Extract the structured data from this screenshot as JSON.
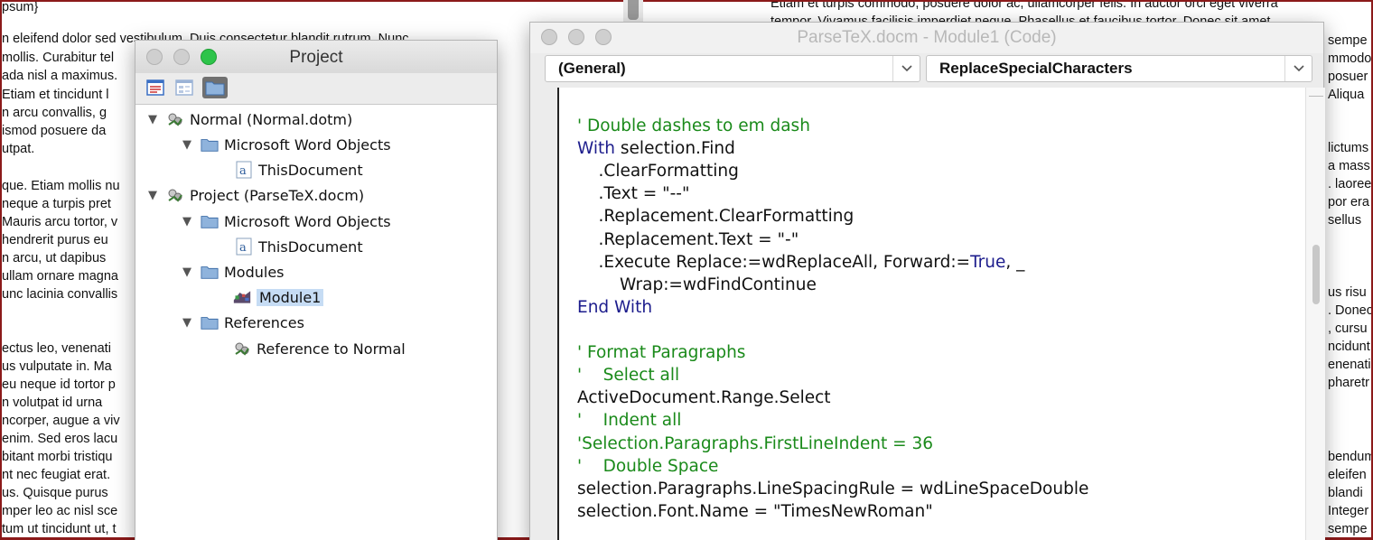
{
  "background_doc_left": {
    "lines": [
      "psum}",
      "n eleifend dolor sed vestibulum. Duis consectetur blandit rutrum. Nunc",
      "mollis. Curabitur tel",
      "ada nisl a maximus.",
      "Etiam et tincidunt l",
      "n arcu convallis, g",
      "ismod posuere da",
      "utpat.",
      "que. Etiam mollis nu",
      "neque a turpis pret",
      "Mauris arcu tortor, v",
      "hendrerit purus eu",
      "n arcu, ut dapibus",
      "ullam ornare magna",
      "unc lacinia convallis",
      "ectus leo, venenati",
      "us vulputate in. Ma",
      "eu neque id tortor p",
      "n volutpat id urna",
      "ncorper, augue a viv",
      "enim. Sed eros lacu",
      "bitant morbi tristiqu",
      "nt nec feugiat erat.",
      "us. Quisque purus",
      "mper leo ac nisl sce",
      "tum ut tincidunt ut, t"
    ]
  },
  "background_doc_right": {
    "lines": [
      "Etiam et turpis commodo, posuere dolor ac, ullamcorper felis. In auctor orci eget viverra",
      "tempor. Vivamus facilisis imperdiet neque. Phasellus et faucibus tortor. Donec sit amet",
      "sempe",
      "mmodo",
      "posuer",
      "Aliqua",
      "lictums",
      "a mass",
      ". laoree",
      "por era",
      "sellus",
      "us risu",
      ". Donec",
      ", cursu",
      "ncidunt",
      "enenati",
      "pharetr",
      "bendum",
      "eleifen",
      " blandi",
      " Integer",
      "sempe"
    ]
  },
  "project_window": {
    "title": "Project",
    "tree": [
      {
        "label": "Normal (Normal.dotm)",
        "icon": "vba-project-icon",
        "expanded": true
      },
      {
        "label": "Microsoft Word Objects",
        "icon": "folder-icon",
        "expanded": true
      },
      {
        "label": "ThisDocument",
        "icon": "word-document-icon"
      },
      {
        "label": "Project (ParseTeX.docm)",
        "icon": "vba-project-icon",
        "expanded": true
      },
      {
        "label": "Microsoft Word Objects",
        "icon": "folder-icon",
        "expanded": true
      },
      {
        "label": "ThisDocument",
        "icon": "word-document-icon"
      },
      {
        "label": "Modules",
        "icon": "folder-icon",
        "expanded": true
      },
      {
        "label": "Module1",
        "icon": "module-icon",
        "selected": true
      },
      {
        "label": "References",
        "icon": "folder-icon",
        "expanded": true
      },
      {
        "label": "Reference to Normal",
        "icon": "vba-project-icon"
      }
    ]
  },
  "code_window": {
    "title": "ParseTeX.docm - Module1 (Code)",
    "object_combo": "(General)",
    "procedure_combo": "ReplaceSpecialCharacters",
    "lines": [
      "' Double dashes to em dash",
      "selection.Find",
      "    .ClearFormatting",
      "    .Text = \"--\"",
      "    .Replacement.ClearFormatting",
      "    .Replacement.Text = \"-\"",
      "    .Execute Replace:=wdReplaceAll, Forward:=",
      ", _",
      "        Wrap:=wdFindContinue",
      "End With",
      "' Format Paragraphs",
      "'    Select all",
      "ActiveDocument.Range.Select",
      "'    Indent all",
      "'Selection.Paragraphs.FirstLineIndent = 36",
      "'    Double Space",
      "selection.Paragraphs.LineSpacingRule = wdLineSpaceDouble",
      "selection.Font.Name = \"TimesNewRoman\""
    ],
    "keywords": {
      "with": "With",
      "true": "True"
    }
  },
  "colors": {
    "comment": "#1a8a1a",
    "keyword": "#1c1c8c",
    "selection": "#c6dcf4",
    "doc_border": "#8b1a1a"
  }
}
